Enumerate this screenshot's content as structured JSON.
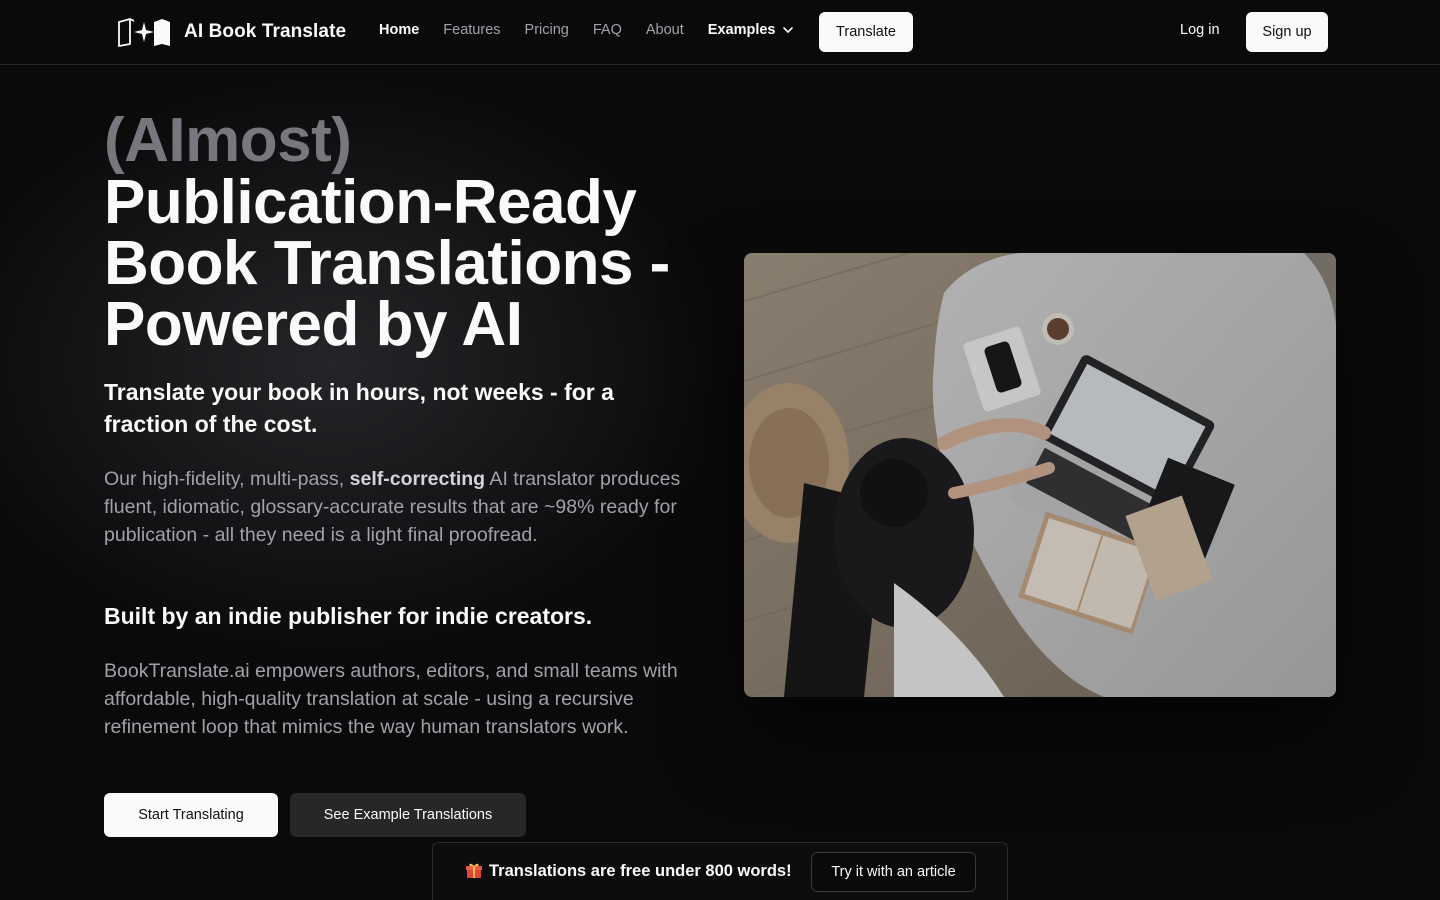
{
  "brand": {
    "name": "AI Book Translate",
    "logo_icon": "book-sparkle-logo"
  },
  "nav": {
    "links": [
      "Home",
      "Features",
      "Pricing",
      "FAQ",
      "About"
    ],
    "examples_label": "Examples",
    "translate_label": "Translate",
    "login_label": "Log in",
    "signup_label": "Sign up"
  },
  "hero": {
    "prefix": "(AImost)",
    "title": "Publication-Ready Book Translations - Powered by AI",
    "subtitle": "Translate your book in hours, not weeks - for a fraction of the cost.",
    "para1_before": "Our high-fidelity, multi-pass, ",
    "para1_bold": "self-correcting",
    "para1_after": " AI translator produces fluent, idiomatic, glossary-accurate results that are ~98% ready for publication - all they need is a light final proofread.",
    "subtitle2": "Built by an indie publisher for indie creators.",
    "para2": "BookTranslate.ai empowers authors, editors, and small teams with affordable, high-quality translation at scale - using a recursive refinement loop that mimics the way human translators work.",
    "cta_primary": "Start Translating",
    "cta_secondary": "See Example Translations"
  },
  "image": {
    "subject": "person-working-on-laptop-with-books-photo"
  },
  "banner": {
    "icon": "gift-icon",
    "text": "Translations are free under 800 words!",
    "button": "Try it with an article"
  },
  "colors": {
    "background": "#0a0a0b",
    "muted": "#a1a1aa",
    "prefix": "#77777d"
  }
}
